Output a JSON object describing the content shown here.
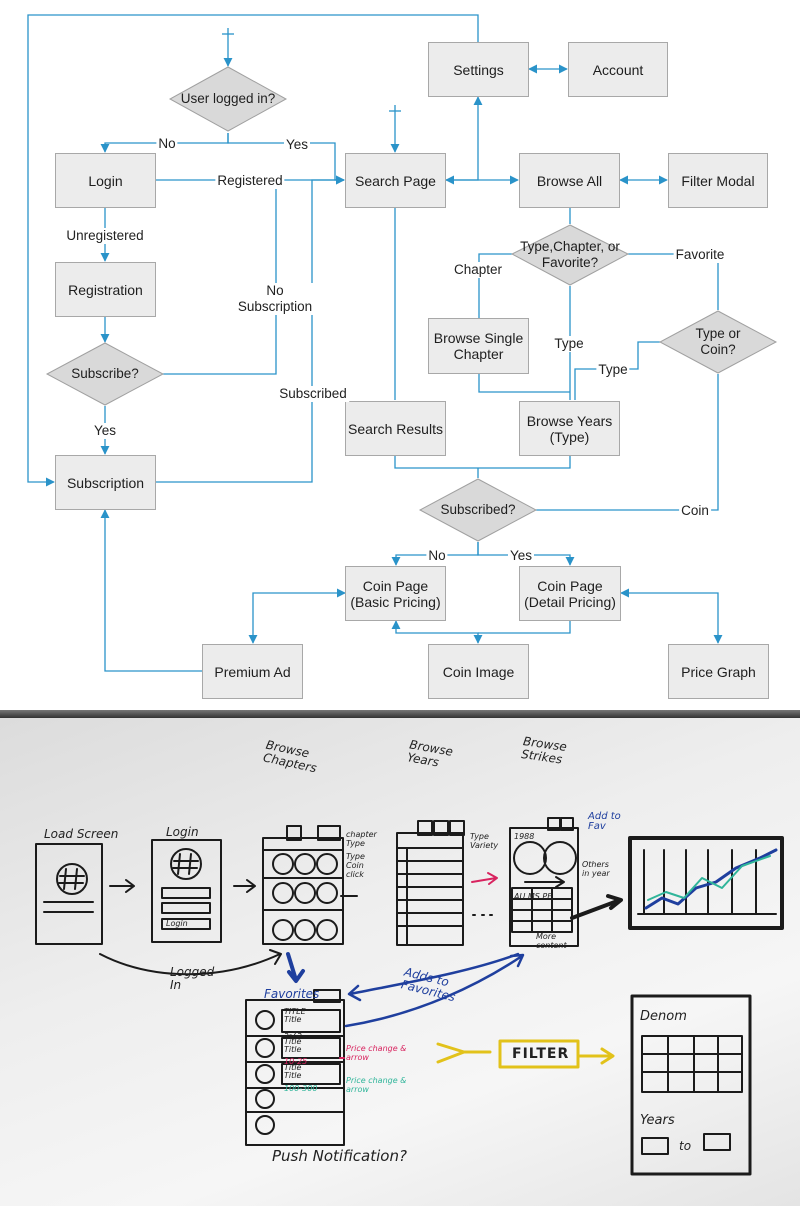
{
  "flowchart": {
    "nodes": {
      "settings": "Settings",
      "account": "Account",
      "login": "Login",
      "search_page": "Search Page",
      "browse_all": "Browse All",
      "filter_modal": "Filter Modal",
      "registration": "Registration",
      "browse_single_chapter": "Browse Single\nChapter",
      "search_results": "Search Results",
      "browse_years": "Browse Years\n(Type)",
      "subscription": "Subscription",
      "coin_page_basic": "Coin Page\n(Basic Pricing)",
      "coin_page_detail": "Coin Page\n(Detail Pricing)",
      "premium_ad": "Premium Ad",
      "coin_image": "Coin Image",
      "price_graph": "Price Graph"
    },
    "decisions": {
      "user_logged_in": "User logged in?",
      "type_chapter_favorite": "Type,Chapter, or\nFavorite?",
      "subscribe": "Subscribe?",
      "type_or_coin": "Type or Coin?",
      "subscribed": "Subscribed?"
    },
    "edge_labels": {
      "no_login": "No",
      "yes_search": "Yes",
      "registered": "Registered",
      "unregistered": "Unregistered",
      "no_subscription": "No\nSubscription",
      "chapter": "Chapter",
      "favorite": "Favorite",
      "type_1": "Type",
      "type_2": "Type",
      "subscribed_edge": "Subscribed",
      "yes_subscription": "Yes",
      "coin": "Coin",
      "no_basic": "No",
      "yes_detail": "Yes"
    },
    "line_color": "#2a93c9"
  },
  "whiteboard": {
    "headers": {
      "browse_chapters": "Browse\nChapters",
      "browse_years": "Browse\nYears",
      "browse_strikes": "Browse\nStrikes"
    },
    "screens": {
      "load_screen": "Load Screen",
      "login": "Login",
      "login_button": "Login",
      "favorites": "Favorites",
      "filter": "FILTER",
      "denom": "Denom",
      "years": "Years",
      "to": "to"
    },
    "notes": {
      "logged_in": "Logged\nIn",
      "adds_to_favorites": "Adds to\nFavorites",
      "add_to_fav": "Add to\nFav",
      "push_notification": "Push Notification?",
      "chapter_type": "chapter\nType",
      "type_coin_click": "Type\nCoin\nclick",
      "type_variety": "Type\nVariety",
      "others_in_year": "Others\nin year",
      "more_content": "More\ncontent",
      "price_change_red": "Price change &\narrow",
      "price_change_teal": "Price change &\narrow",
      "title_1": "TITLE\nTitle",
      "range_1": "5-75",
      "title_2": "Title\nTitle",
      "range_2": "10-25",
      "title_3": "Title\nTitle",
      "range_3": "100-300",
      "year": "1988",
      "grades": "AU MS PF"
    },
    "colors": {
      "marker_black": "#1b1b1b",
      "marker_blue": "#1f3f9e",
      "marker_red": "#d8235f",
      "marker_teal": "#2fb59a",
      "marker_yellow": "#e2c21a"
    }
  }
}
